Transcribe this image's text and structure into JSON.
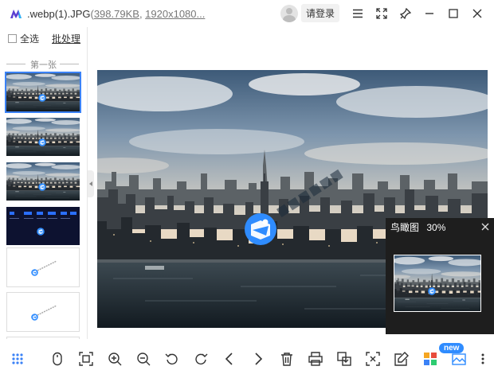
{
  "window": {
    "file_name": ".webp(1).JPG",
    "open_paren": "(",
    "file_size": "398.79KB",
    "separator": ", ",
    "dimensions": "1920x1080..."
  },
  "user": {
    "login_label": "请登录"
  },
  "sidebar": {
    "select_all_label": "全选",
    "batch_label": "批处理",
    "group_label": "第一张",
    "thumbnails": [
      {
        "kind": "city",
        "active": true
      },
      {
        "kind": "city",
        "active": false
      },
      {
        "kind": "city",
        "active": false
      },
      {
        "kind": "dark-ui",
        "active": false
      },
      {
        "kind": "logo",
        "active": false
      },
      {
        "kind": "logo",
        "active": false
      }
    ]
  },
  "birdseye": {
    "title": "鸟瞰图",
    "zoom": "30%"
  },
  "toolbar": {
    "new_badge": "new",
    "tools": [
      "grid-icon",
      "mouse-icon",
      "fit-window-icon",
      "zoom-in-icon",
      "zoom-out-icon",
      "rotate-left-icon",
      "rotate-right-icon",
      "prev-icon",
      "next-icon",
      "delete-icon",
      "print-icon",
      "convert-icon",
      "crop-icon",
      "edit-icon",
      "apps-icon",
      "gallery-icon",
      "more-icon"
    ]
  },
  "colors": {
    "accent": "#3b82f6",
    "logo": "#5b3fd1",
    "birdseye_bg": "#1e1e1e",
    "badge": "#2f8cff"
  }
}
